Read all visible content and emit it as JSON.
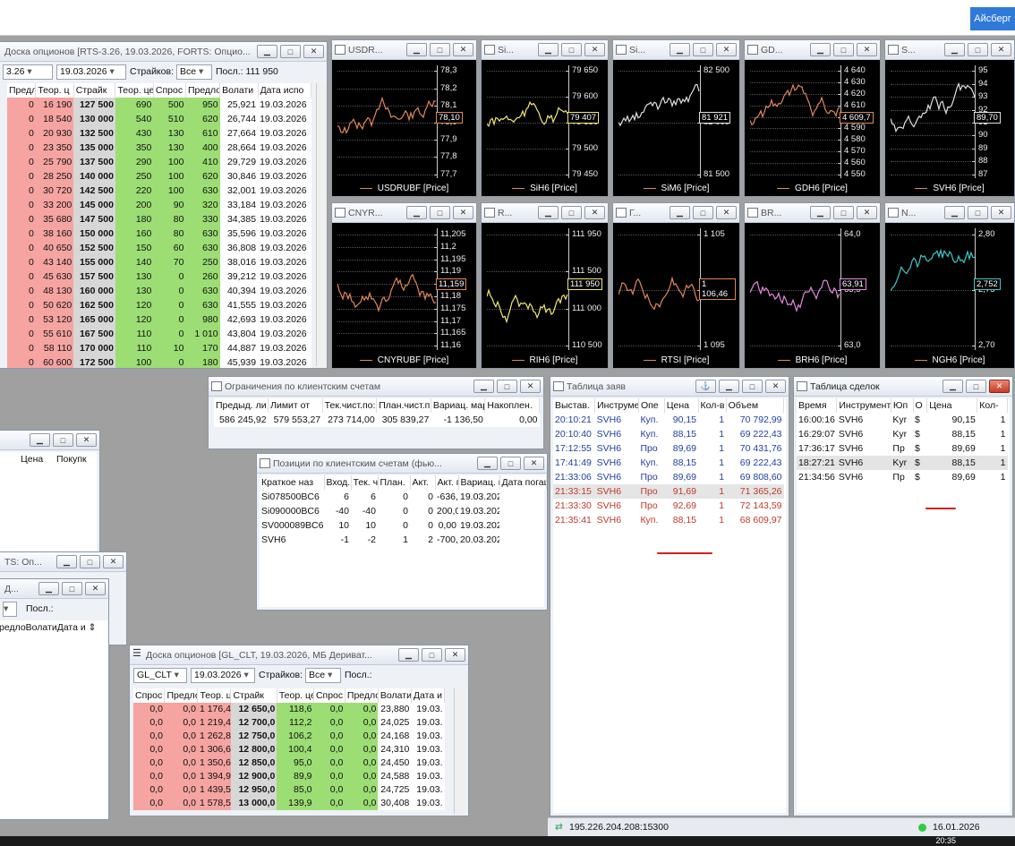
{
  "topbar": {
    "button": "Айсберг"
  },
  "opt1": {
    "title": "Доска опционов [RTS-3.26, 19.03.2026, FORTS: Опцио...",
    "series": "3.26",
    "date": "19.03.2026",
    "strikes_label": "Страйков:",
    "strikes_val": "Все",
    "last_label": "Посл.: 111 950",
    "headers": [
      "Предло",
      "Теор. ц",
      "Страйк",
      "Теор. це",
      "Спрос",
      "Предло",
      "Волати",
      "Дата испо"
    ],
    "rows": [
      [
        "0",
        "16 190",
        "127 500",
        "690",
        "500",
        "950",
        "25,921",
        "19.03.2026"
      ],
      [
        "0",
        "18 540",
        "130 000",
        "540",
        "510",
        "620",
        "26,744",
        "19.03.2026"
      ],
      [
        "0",
        "20 930",
        "132 500",
        "430",
        "130",
        "610",
        "27,664",
        "19.03.2026"
      ],
      [
        "0",
        "23 350",
        "135 000",
        "350",
        "130",
        "400",
        "28,664",
        "19.03.2026"
      ],
      [
        "0",
        "25 790",
        "137 500",
        "290",
        "100",
        "410",
        "29,729",
        "19.03.2026"
      ],
      [
        "0",
        "28 250",
        "140 000",
        "250",
        "100",
        "620",
        "30,846",
        "19.03.2026"
      ],
      [
        "0",
        "30 720",
        "142 500",
        "220",
        "100",
        "630",
        "32,001",
        "19.03.2026"
      ],
      [
        "0",
        "33 200",
        "145 000",
        "200",
        "90",
        "320",
        "33,184",
        "19.03.2026"
      ],
      [
        "0",
        "35 680",
        "147 500",
        "180",
        "80",
        "330",
        "34,385",
        "19.03.2026"
      ],
      [
        "0",
        "38 160",
        "150 000",
        "160",
        "80",
        "630",
        "35,596",
        "19.03.2026"
      ],
      [
        "0",
        "40 650",
        "152 500",
        "150",
        "60",
        "630",
        "36,808",
        "19.03.2026"
      ],
      [
        "0",
        "43 140",
        "155 000",
        "140",
        "70",
        "250",
        "38,016",
        "19.03.2026"
      ],
      [
        "0",
        "45 630",
        "157 500",
        "130",
        "0",
        "260",
        "39,212",
        "19.03.2026"
      ],
      [
        "0",
        "48 130",
        "160 000",
        "130",
        "0",
        "630",
        "40,394",
        "19.03.2026"
      ],
      [
        "0",
        "50 620",
        "162 500",
        "120",
        "0",
        "630",
        "41,555",
        "19.03.2026"
      ],
      [
        "0",
        "53 120",
        "165 000",
        "120",
        "0",
        "980",
        "42,693",
        "19.03.2026"
      ],
      [
        "0",
        "55 610",
        "167 500",
        "110",
        "0",
        "1 010",
        "43,804",
        "19.03.2026"
      ],
      [
        "0",
        "58 110",
        "170 000",
        "110",
        "10",
        "170",
        "44,887",
        "19.03.2026"
      ],
      [
        "0",
        "60 600",
        "172 500",
        "100",
        "0",
        "180",
        "45,939",
        "19.03.2026"
      ]
    ]
  },
  "charts": [
    {
      "id": "usd",
      "title": "USDR...",
      "legend": "USDRUBF [Price]",
      "color": "#e0875a",
      "ticks": [
        "78,3",
        "78,2",
        "78,1",
        "78,0",
        "77,9",
        "77,8",
        "77,7"
      ],
      "last": "78,10"
    },
    {
      "id": "sih",
      "title": "Si...",
      "legend": "SiH6 [Price]",
      "color": "#f0e870",
      "ticks": [
        "79 650",
        "79 600",
        "79 550",
        "79 500",
        "79 450"
      ],
      "last": "79 407"
    },
    {
      "id": "sim",
      "title": "Si...",
      "legend": "SiM6 [Price]",
      "color": "#e0e0e0",
      "ticks": [
        "82 500",
        "82 000",
        "81 500"
      ],
      "last": "81 921"
    },
    {
      "id": "gdh",
      "title": "GD...",
      "legend": "GDH6 [Price]",
      "color": "#e0875a",
      "ticks": [
        "4 640",
        "4 630",
        "4 620",
        "4 610",
        "4 600",
        "4 590",
        "4 580",
        "4 570",
        "4 560",
        "4 550"
      ],
      "last": "4 609,7"
    },
    {
      "id": "svh",
      "title": "S...",
      "legend": "SVH6 [Price]",
      "color": "#e0e0e0",
      "ticks": [
        "95",
        "94",
        "93",
        "92",
        "91",
        "90",
        "89",
        "88",
        "87"
      ],
      "last": "89,70"
    },
    {
      "id": "cny",
      "title": "CNYR...",
      "legend": "CNYRUBF [Price]",
      "color": "#e0875a",
      "ticks": [
        "11,205",
        "11,2",
        "11,195",
        "11,19",
        "11,185",
        "11,18",
        "11,175",
        "11,17",
        "11,165",
        "11,16"
      ],
      "last": "11,159"
    },
    {
      "id": "rih",
      "title": "R...",
      "legend": "RIH6 [Price]",
      "color": "#f0e870",
      "ticks": [
        "111 950",
        "111 500",
        "111 000",
        "110 500"
      ],
      "last": "111 950"
    },
    {
      "id": "rts",
      "title": "Г...",
      "legend": "RTSI [Price]",
      "color": "#e0875a",
      "ticks": [
        "1 105",
        "1 100",
        "1 095"
      ],
      "last": "1 106,46"
    },
    {
      "id": "brh",
      "title": "BR...",
      "legend": "BRH6 [Price]",
      "color": "#e38ae0",
      "ticks": [
        "64,0",
        "63,5",
        "63,0"
      ],
      "last": "63,91"
    },
    {
      "id": "ngh",
      "title": "N...",
      "legend": "NGH6 [Price]",
      "color": "#3cc8c8",
      "ticks": [
        "2,80",
        "2,75",
        "2,70"
      ],
      "last": "2,752"
    }
  ],
  "limits": {
    "title": "Ограничения по клиентским счетам",
    "headers": [
      "Предыд. ли",
      "Лимит от",
      "Тек.чист.по:",
      "План.чист.п",
      "Вариац. мар",
      "Накоплен."
    ],
    "row": [
      "586 245,92",
      "579 553,27",
      "273 714,00",
      "305 839,27",
      "-1 136,50",
      "0,00"
    ]
  },
  "positions": {
    "title": "Позиции по клиентским счетам (фью...",
    "headers": [
      "Краткое наз",
      "Вход.",
      "Тек. ч",
      "План.",
      "Акт.",
      "Акт. г",
      "Вариац. ма",
      "Дата погаш"
    ],
    "rows": [
      [
        "Si078500BC6",
        "6",
        "6",
        "0",
        "0",
        "-636,00",
        "19.03.2026"
      ],
      [
        "Si090000BC6",
        "-40",
        "-40",
        "0",
        "0",
        "200,00",
        "19.03.2026"
      ],
      [
        "SV000089BC6",
        "10",
        "10",
        "0",
        "0",
        "0,00",
        "19.03.2026"
      ],
      [
        "SVH6",
        "-1",
        "-2",
        "1",
        "2",
        "-700,50",
        "20.03.2026"
      ]
    ]
  },
  "orders": {
    "title": "Таблица заяв",
    "headers": [
      "Выстав.",
      "Инструме",
      "Опе",
      "Цена",
      "Кол-в",
      "Объем"
    ],
    "rows": [
      [
        "20:10:21",
        "SVH6",
        "Куп.",
        "90,15",
        "1",
        "70 792,99",
        "blue"
      ],
      [
        "20:10:40",
        "SVH6",
        "Куп.",
        "88,15",
        "1",
        "69 222,43",
        "blue"
      ],
      [
        "17:12:55",
        "SVH6",
        "Про",
        "89,69",
        "1",
        "70 431,76",
        "blue"
      ],
      [
        "17:41:49",
        "SVH6",
        "Куп.",
        "88,15",
        "1",
        "69 222,43",
        "blue"
      ],
      [
        "21:33:06",
        "SVH6",
        "Про",
        "89,69",
        "1",
        "69 808,60",
        "blue"
      ],
      [
        "21:33:15",
        "SVH6",
        "Про",
        "91,69",
        "1",
        "71 365,26",
        "red"
      ],
      [
        "21:33:30",
        "SVH6",
        "Про",
        "92,69",
        "1",
        "72 143,59",
        "red"
      ],
      [
        "21:35:41",
        "SVH6",
        "Куп.",
        "88,15",
        "1",
        "68 609,97",
        "red"
      ]
    ]
  },
  "deals": {
    "title": "Таблица сделок",
    "headers": [
      "Время",
      "Инструмент",
      "Юп",
      "О",
      "Цена",
      "Кол-"
    ],
    "rows": [
      [
        "16:00:16",
        "SVH6",
        "Kyr",
        "$",
        "90,15",
        "1"
      ],
      [
        "16:29:07",
        "SVH6",
        "Kyr",
        "$",
        "88,15",
        "1"
      ],
      [
        "17:36:17",
        "SVH6",
        "Пр",
        "$",
        "89,69",
        "1"
      ],
      [
        "18:27:21",
        "SVH6",
        "Kyr",
        "$",
        "88,15",
        "1"
      ],
      [
        "21:34:56",
        "SVH6",
        "Пр",
        "$",
        "89,69",
        "1"
      ]
    ]
  },
  "small1": {
    "headers": [
      "Цена",
      "Покупк"
    ]
  },
  "small2": {
    "title": "TS: Оп...",
    "title2": "Д...",
    "last": "Посл.:",
    "headers": [
      "редло",
      "Волати",
      "Дата и"
    ]
  },
  "opt2": {
    "title": "Доска опционов [GL_CLT, 19.03.2026, МБ Дериват...",
    "series": "GL_CLT",
    "date": "19.03.2026",
    "strikes_label": "Страйков:",
    "strikes_val": "Все",
    "last_label": "Посл.:",
    "headers": [
      "Спрос",
      "Предло",
      "Теор. ц",
      "Страйк",
      "Теор. це",
      "Спрос",
      "Предло",
      "Волати",
      "Дата и"
    ],
    "rows": [
      [
        "0,0",
        "0,0",
        "1 176,4",
        "12 650,0",
        "118,6",
        "0,0",
        "0,0",
        "23,880",
        "19.03."
      ],
      [
        "0,0",
        "0,0",
        "1 219,4",
        "12 700,0",
        "112,2",
        "0,0",
        "0,0",
        "24,025",
        "19.03."
      ],
      [
        "0,0",
        "0,0",
        "1 262,8",
        "12 750,0",
        "106,2",
        "0,0",
        "0,0",
        "24,168",
        "19.03."
      ],
      [
        "0,0",
        "0,0",
        "1 306,6",
        "12 800,0",
        "100,4",
        "0,0",
        "0,0",
        "24,310",
        "19.03."
      ],
      [
        "0,0",
        "0,0",
        "1 350,6",
        "12 850,0",
        "95,0",
        "0,0",
        "0,0",
        "24,450",
        "19.03."
      ],
      [
        "0,0",
        "0,0",
        "1 394,9",
        "12 900,0",
        "89,9",
        "0,0",
        "0,0",
        "24,588",
        "19.03."
      ],
      [
        "0,0",
        "0,0",
        "1 439,5",
        "12 950,0",
        "85,0",
        "0,0",
        "0,0",
        "24,725",
        "19.03."
      ],
      [
        "0,0",
        "0,0",
        "1 578,5",
        "13 000,0",
        "139,9",
        "0,0",
        "0,0",
        "30,408",
        "19.03."
      ]
    ]
  },
  "status": {
    "server": "195.226.204.208:15300",
    "date": "16.01.2026",
    "clock": "20:35"
  }
}
